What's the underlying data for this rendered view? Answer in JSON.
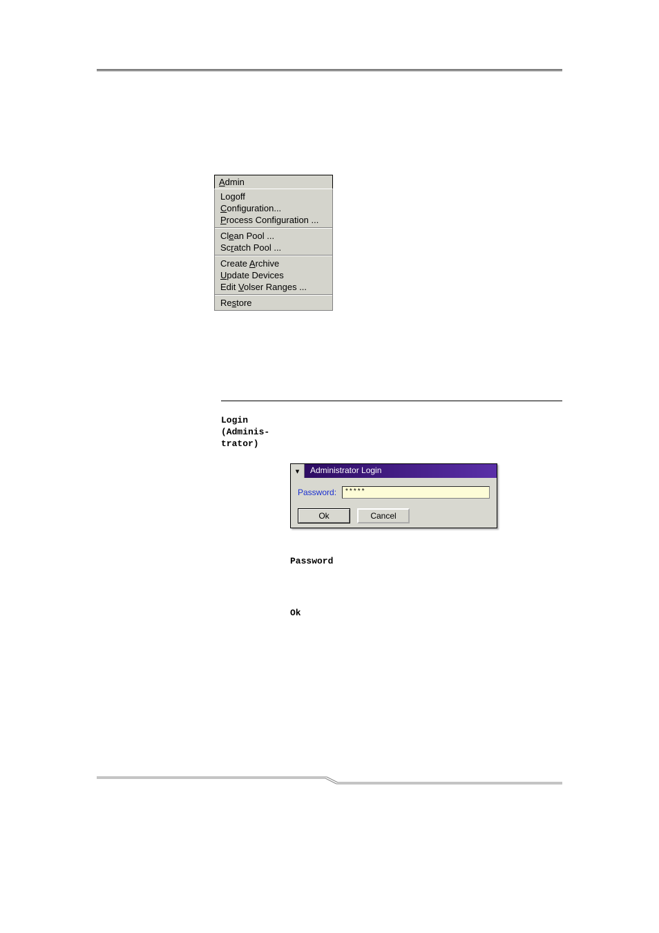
{
  "menu": {
    "header_prefix": "A",
    "header_rest": "dmin",
    "items": [
      {
        "pre": "",
        "u": "",
        "post": "Logoff"
      },
      {
        "pre": "",
        "u": "C",
        "post": "onfiguration..."
      },
      {
        "pre": "",
        "u": "P",
        "post": "rocess Configuration ..."
      },
      {
        "sep": true
      },
      {
        "pre": "Cl",
        "u": "e",
        "post": "an Pool ..."
      },
      {
        "pre": "Sc",
        "u": "r",
        "post": "atch Pool ..."
      },
      {
        "sep": true
      },
      {
        "pre": "Create ",
        "u": "A",
        "post": "rchive"
      },
      {
        "pre": "",
        "u": "U",
        "post": "pdate Devices"
      },
      {
        "pre": "Edit ",
        "u": "V",
        "post": "olser Ranges ..."
      },
      {
        "sep": true
      },
      {
        "pre": "Re",
        "u": "s",
        "post": "tore"
      }
    ]
  },
  "section": {
    "label_line1": "Login",
    "label_line2": "(Adminis-",
    "label_line3": "trator)"
  },
  "dialog": {
    "sysicon": "▾",
    "title": "Administrator Login",
    "password_label": "Password:",
    "password_value": "*****",
    "ok_label": "Ok",
    "cancel_label": "Cancel"
  },
  "defs": {
    "term1": "Password",
    "term2": "Ok"
  }
}
